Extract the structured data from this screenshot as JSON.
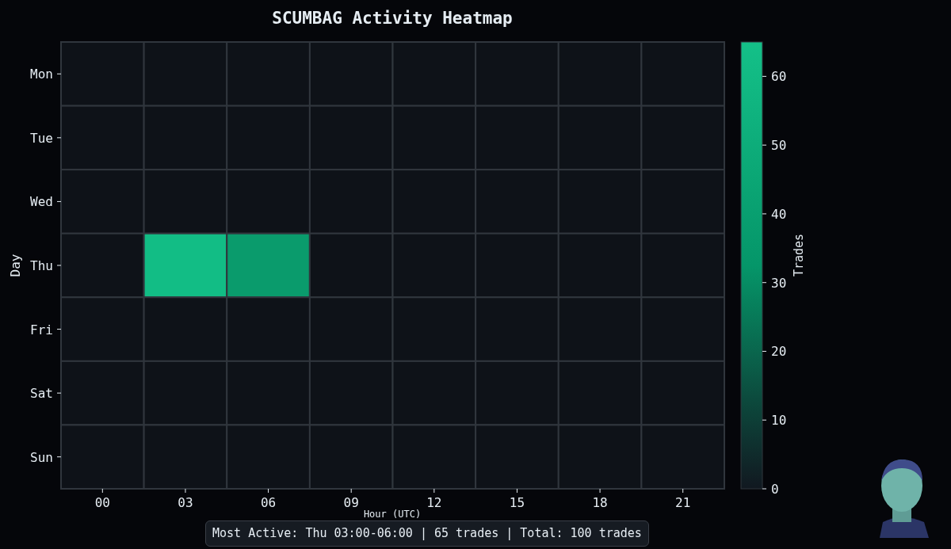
{
  "heatmap": {
    "title": "SCUMBAG Activity Heatmap",
    "xlabel": "Hour (UTC)",
    "ylabel": "Day",
    "x_ticks": [
      "00",
      "03",
      "06",
      "09",
      "12",
      "15",
      "18",
      "21"
    ],
    "rows": [
      {
        "label": "Mon",
        "cells": [
          {
            "color": "#0e1218"
          },
          {
            "color": "#0e1218"
          },
          {
            "color": "#0e1218"
          },
          {
            "color": "#0e1218"
          },
          {
            "color": "#0e1218"
          },
          {
            "color": "#0e1218"
          },
          {
            "color": "#0e1218"
          },
          {
            "color": "#0e1218"
          }
        ]
      },
      {
        "label": "Tue",
        "cells": [
          {
            "color": "#0e1218"
          },
          {
            "color": "#0e1218"
          },
          {
            "color": "#0e1218"
          },
          {
            "color": "#0e1218"
          },
          {
            "color": "#0e1218"
          },
          {
            "color": "#0e1218"
          },
          {
            "color": "#0e1218"
          },
          {
            "color": "#0e1218"
          }
        ]
      },
      {
        "label": "Wed",
        "cells": [
          {
            "color": "#0e1218"
          },
          {
            "color": "#0e1218"
          },
          {
            "color": "#0e1218"
          },
          {
            "color": "#0e1218"
          },
          {
            "color": "#0e1218"
          },
          {
            "color": "#0e1218"
          },
          {
            "color": "#0e1218"
          },
          {
            "color": "#0e1218"
          }
        ]
      },
      {
        "label": "Thu",
        "cells": [
          {
            "color": "#0e1218"
          },
          {
            "color": "#12bd85"
          },
          {
            "color": "#0a9b6c"
          },
          {
            "color": "#0e1218"
          },
          {
            "color": "#0e1218"
          },
          {
            "color": "#0e1218"
          },
          {
            "color": "#0e1218"
          },
          {
            "color": "#0e1218"
          }
        ]
      },
      {
        "label": "Fri",
        "cells": [
          {
            "color": "#0e1218"
          },
          {
            "color": "#0e1218"
          },
          {
            "color": "#0e1218"
          },
          {
            "color": "#0e1218"
          },
          {
            "color": "#0e1218"
          },
          {
            "color": "#0e1218"
          },
          {
            "color": "#0e1218"
          },
          {
            "color": "#0e1218"
          }
        ]
      },
      {
        "label": "Sat",
        "cells": [
          {
            "color": "#0e1218"
          },
          {
            "color": "#0e1218"
          },
          {
            "color": "#0e1218"
          },
          {
            "color": "#0e1218"
          },
          {
            "color": "#0e1218"
          },
          {
            "color": "#0e1218"
          },
          {
            "color": "#0e1218"
          },
          {
            "color": "#0e1218"
          }
        ]
      },
      {
        "label": "Sun",
        "cells": [
          {
            "color": "#0e1218"
          },
          {
            "color": "#0e1218"
          },
          {
            "color": "#0e1218"
          },
          {
            "color": "#0e1218"
          },
          {
            "color": "#0e1218"
          },
          {
            "color": "#0e1218"
          },
          {
            "color": "#0e1218"
          },
          {
            "color": "#0e1218"
          }
        ]
      }
    ]
  },
  "colorbar": {
    "label": "Trades",
    "ticks": [
      "60",
      "50",
      "40",
      "30",
      "20",
      "10",
      "0"
    ]
  },
  "summary": "Most Active: Thu 03:00-06:00 | 65 trades | Total: 100 trades"
}
